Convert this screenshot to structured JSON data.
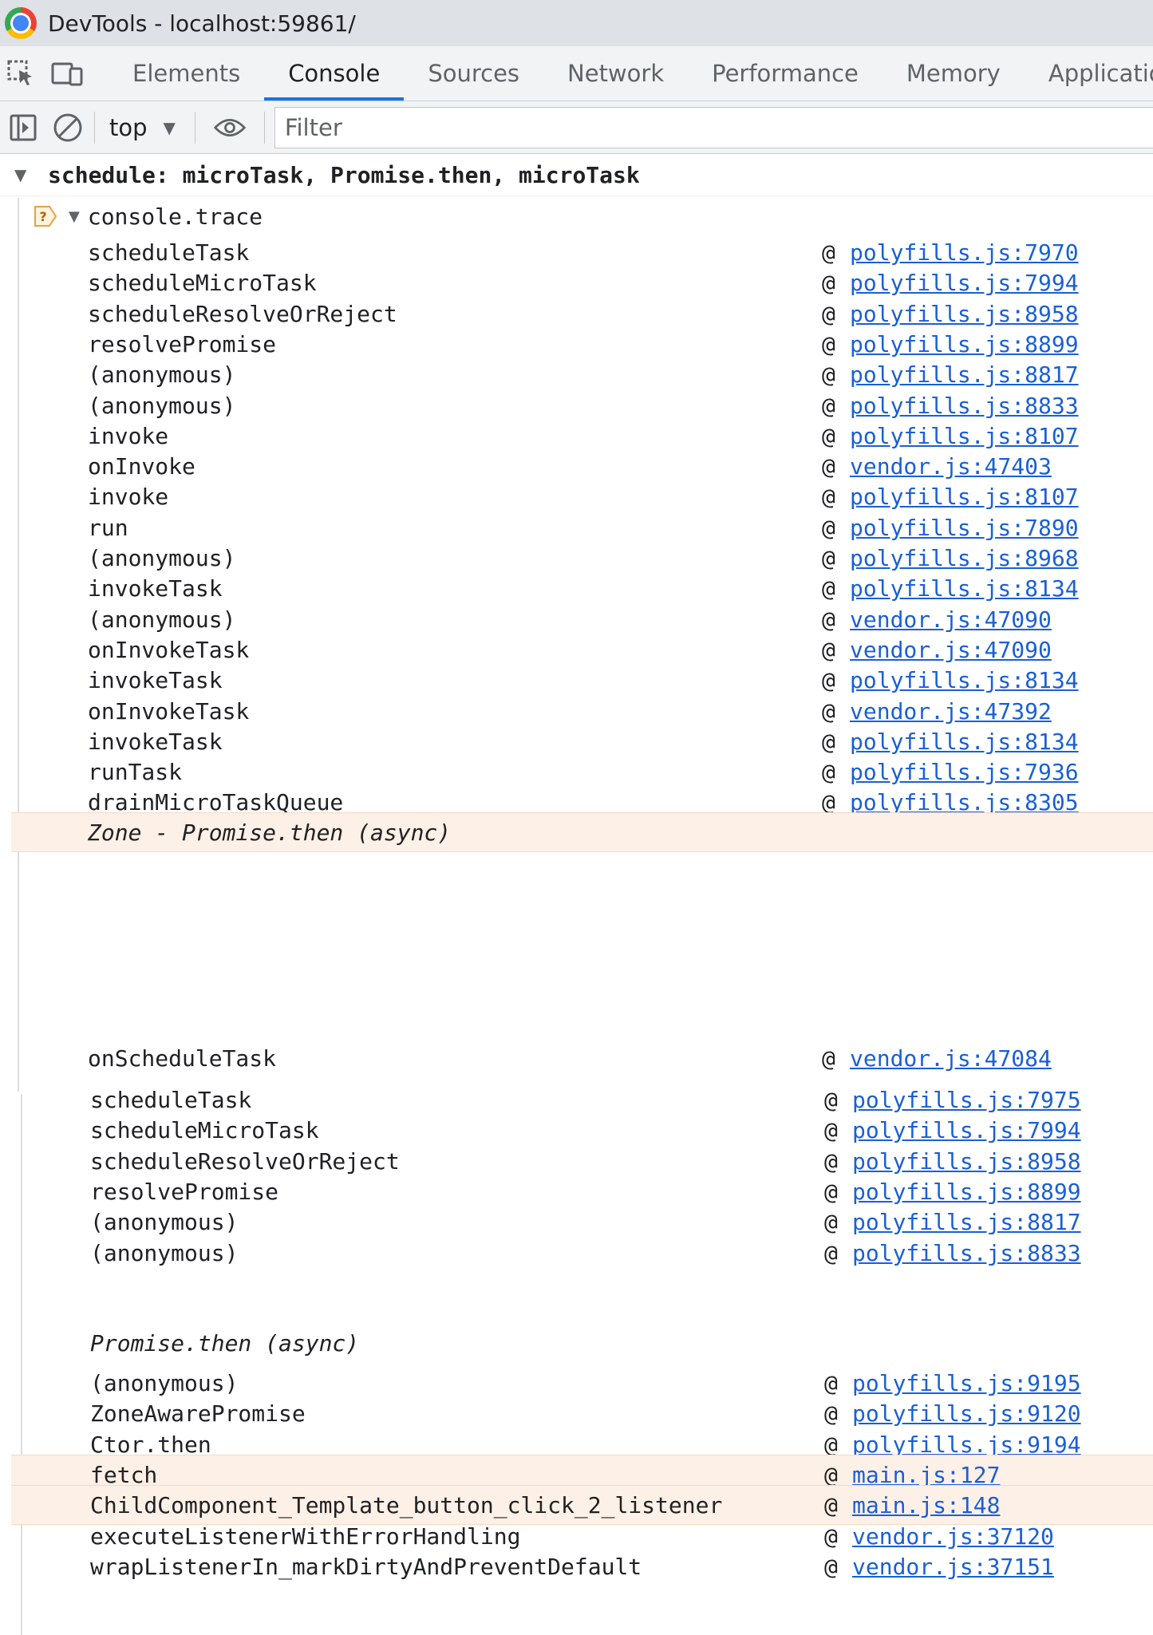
{
  "window": {
    "title": "DevTools - localhost:59861/"
  },
  "tabs": [
    {
      "label": "Elements",
      "active": false
    },
    {
      "label": "Console",
      "active": true
    },
    {
      "label": "Sources",
      "active": false
    },
    {
      "label": "Network",
      "active": false
    },
    {
      "label": "Performance",
      "active": false
    },
    {
      "label": "Memory",
      "active": false
    },
    {
      "label": "Application",
      "active": false
    }
  ],
  "toolbar": {
    "context": "top",
    "filter_placeholder": "Filter"
  },
  "console": {
    "group_title": "schedule: microTask, Promise.then, microTask",
    "trace_title": "console.trace",
    "block1": [
      {
        "fn": "scheduleTask",
        "loc": "polyfills.js:7970"
      },
      {
        "fn": "scheduleMicroTask",
        "loc": "polyfills.js:7994"
      },
      {
        "fn": "scheduleResolveOrReject",
        "loc": "polyfills.js:8958"
      },
      {
        "fn": "resolvePromise",
        "loc": "polyfills.js:8899"
      },
      {
        "fn": "(anonymous)",
        "loc": "polyfills.js:8817"
      },
      {
        "fn": "(anonymous)",
        "loc": "polyfills.js:8833"
      },
      {
        "fn": "invoke",
        "loc": "polyfills.js:8107"
      },
      {
        "fn": "onInvoke",
        "loc": "vendor.js:47403"
      },
      {
        "fn": "invoke",
        "loc": "polyfills.js:8107"
      },
      {
        "fn": "run",
        "loc": "polyfills.js:7890"
      },
      {
        "fn": "(anonymous)",
        "loc": "polyfills.js:8968"
      },
      {
        "fn": "invokeTask",
        "loc": "polyfills.js:8134"
      },
      {
        "fn": "(anonymous)",
        "loc": "vendor.js:47090"
      },
      {
        "fn": "onInvokeTask",
        "loc": "vendor.js:47090"
      },
      {
        "fn": "invokeTask",
        "loc": "polyfills.js:8134"
      },
      {
        "fn": "onInvokeTask",
        "loc": "vendor.js:47392"
      },
      {
        "fn": "invokeTask",
        "loc": "polyfills.js:8134"
      },
      {
        "fn": "runTask",
        "loc": "polyfills.js:7936"
      },
      {
        "fn": "drainMicroTaskQueue",
        "loc": "polyfills.js:8305"
      }
    ],
    "async1": "Zone - Promise.then (async)",
    "block1b": [
      {
        "fn": "onScheduleTask",
        "loc": "vendor.js:47084"
      }
    ],
    "block2": [
      {
        "fn": "scheduleTask",
        "loc": "polyfills.js:7975"
      },
      {
        "fn": "scheduleMicroTask",
        "loc": "polyfills.js:7994"
      },
      {
        "fn": "scheduleResolveOrReject",
        "loc": "polyfills.js:8958"
      },
      {
        "fn": "resolvePromise",
        "loc": "polyfills.js:8899"
      },
      {
        "fn": "(anonymous)",
        "loc": "polyfills.js:8817"
      },
      {
        "fn": "(anonymous)",
        "loc": "polyfills.js:8833"
      }
    ],
    "async2": "Promise.then (async)",
    "block3": [
      {
        "fn": "(anonymous)",
        "loc": "polyfills.js:9195",
        "hl": false
      },
      {
        "fn": "ZoneAwarePromise",
        "loc": "polyfills.js:9120",
        "hl": false
      },
      {
        "fn": "Ctor.then",
        "loc": "polyfills.js:9194",
        "hl": false
      },
      {
        "fn": "fetch",
        "loc": "main.js:127",
        "hl": true
      },
      {
        "fn": "ChildComponent_Template_button_click_2_listener",
        "loc": "main.js:148",
        "hl": true
      },
      {
        "fn": "executeListenerWithErrorHandling",
        "loc": "vendor.js:37120",
        "hl": false
      },
      {
        "fn": "wrapListenerIn_markDirtyAndPreventDefault",
        "loc": "vendor.js:37151",
        "hl": false
      }
    ]
  }
}
